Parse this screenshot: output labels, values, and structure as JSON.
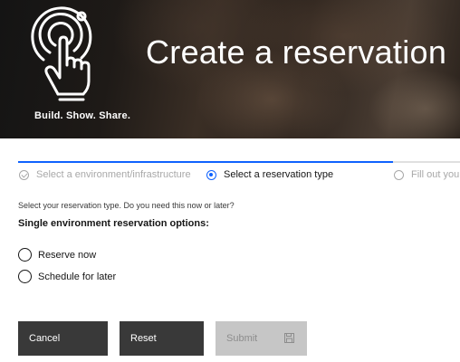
{
  "header": {
    "title": "Create a reservation",
    "tagline": "Build. Show. Share.",
    "logo_icon": "touch-tap-icon"
  },
  "progress": {
    "steps": [
      {
        "label": "Select a environment/infrastructure",
        "status": "complete"
      },
      {
        "label": "Select a reservation type",
        "status": "current"
      },
      {
        "label": "Fill out your",
        "status": "incomplete"
      }
    ]
  },
  "form": {
    "helper_text": "Select your reservation type. Do you need this now or later?",
    "group_title": "Single environment reservation options:",
    "options": [
      {
        "label": "Reserve now",
        "selected": false
      },
      {
        "label": "Schedule for later",
        "selected": false
      }
    ]
  },
  "buttons": {
    "cancel": "Cancel",
    "reset": "Reset",
    "submit": "Submit",
    "submit_icon": "save-icon",
    "submit_disabled": true
  },
  "colors": {
    "accent": "#0f62fe",
    "button_dark": "#393939",
    "button_disabled": "#c6c6c6",
    "text": "#161616"
  }
}
